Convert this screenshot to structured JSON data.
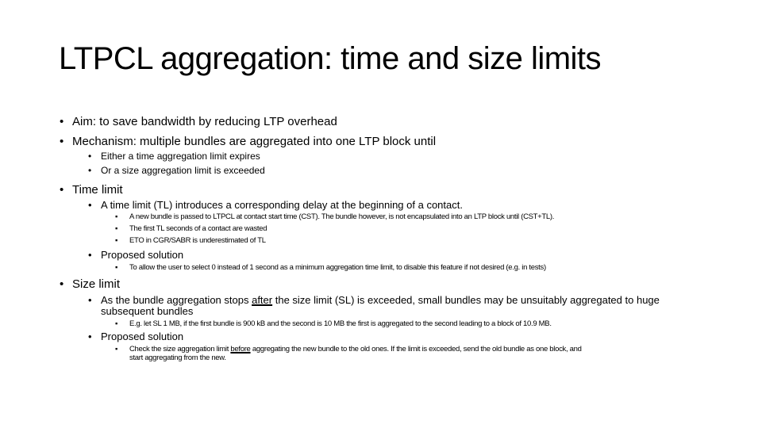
{
  "slide": {
    "title": "LTPCL aggregation: time and size limits",
    "bullet_glyph": "•",
    "sub_bullet_glyph": "▪",
    "items": {
      "aim": "Aim: to save bandwidth by reducing LTP overhead",
      "mechanism": "Mechanism: multiple bundles are aggregated into one LTP block until",
      "mechanism_either": "Either a time aggregation limit expires",
      "mechanism_or": "Or a size aggregation limit is exceeded",
      "time_limit": "Time limit",
      "tl_intro": "A time limit (TL) introduces a corresponding delay at the beginning of a contact.",
      "tl_detail_1": "A new bundle is passed to LTPCL at contact start time (CST). The bundle however, is not encapsulated into an LTP block until (CST+TL).",
      "tl_detail_2": "The first TL seconds of a contact are wasted",
      "tl_detail_3": "ETO in CGR/SABR is underestimated of TL",
      "tl_solution": "Proposed solution",
      "tl_solution_detail": "To allow the user to select 0 instead of 1 second as a minimum aggregation time limit, to disable this feature if not desired (e.g. in tests)",
      "size_limit": "Size limit",
      "sl_intro_pre": "As the bundle aggregation stops ",
      "sl_intro_underlined": "after",
      "sl_intro_post": " the size limit (SL) is exceeded, small bundles may be unsuitably aggregated to huge",
      "sl_intro_line2": "subsequent bundles",
      "sl_example": "E.g. let SL 1 MB, if the first bundle is 900 kB and the second is 10 MB the first is aggregated to the second leading to a block of 10.9 MB.",
      "sl_solution": "Proposed solution",
      "sl_solution_pre": "Check the size aggregation limit ",
      "sl_solution_underlined": "before",
      "sl_solution_post": " aggregating the new bundle to the old ones. If the limit is exceeded, send the old bundle as one block, and",
      "sl_solution_line2": "start aggregating from the new."
    }
  }
}
